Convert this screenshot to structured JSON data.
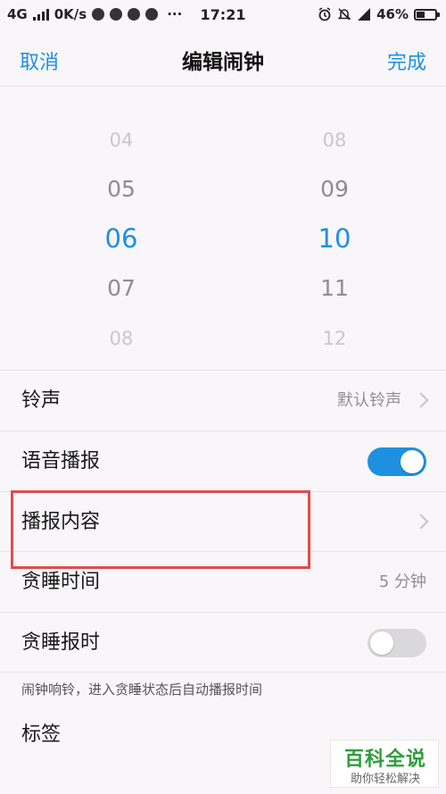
{
  "status_bar": {
    "network": "4G",
    "speed": "0K/s",
    "dots": "···",
    "time": "17:21",
    "battery": "46%",
    "battery_level": 0.46,
    "icons": [
      "signal-icon",
      "wechat-icon",
      "qq-icon",
      "browser-icon",
      "weibo-icon",
      "alarm-icon",
      "mute-icon",
      "4g-icon",
      "battery-icon"
    ]
  },
  "header": {
    "cancel": "取消",
    "title": "编辑闹钟",
    "done": "完成"
  },
  "hour_picker": [
    "04",
    "05",
    "06",
    "07",
    "08"
  ],
  "minute_picker": [
    "08",
    "09",
    "10",
    "11",
    "12"
  ],
  "selected": {
    "hour": "06",
    "minute": "10"
  },
  "rows": {
    "ringtone": {
      "label": "铃声",
      "value": "默认铃声"
    },
    "voice_broadcast": {
      "label": "语音播报",
      "on": true
    },
    "broadcast_content": {
      "label": "播报内容"
    },
    "snooze_time": {
      "label": "贪睡时间",
      "value": "5 分钟"
    },
    "snooze_report": {
      "label": "贪睡报时",
      "on": false
    },
    "hint": "闹钟响铃，进入贪睡状态后自动播报时间",
    "tag": {
      "label": "标签"
    }
  },
  "watermark": {
    "title": "百科全说",
    "subtitle": "助你轻松解决"
  },
  "colors": {
    "accent": "#1e90e0",
    "highlight": "#e04c4c",
    "watermark": "#2e9e3a"
  }
}
